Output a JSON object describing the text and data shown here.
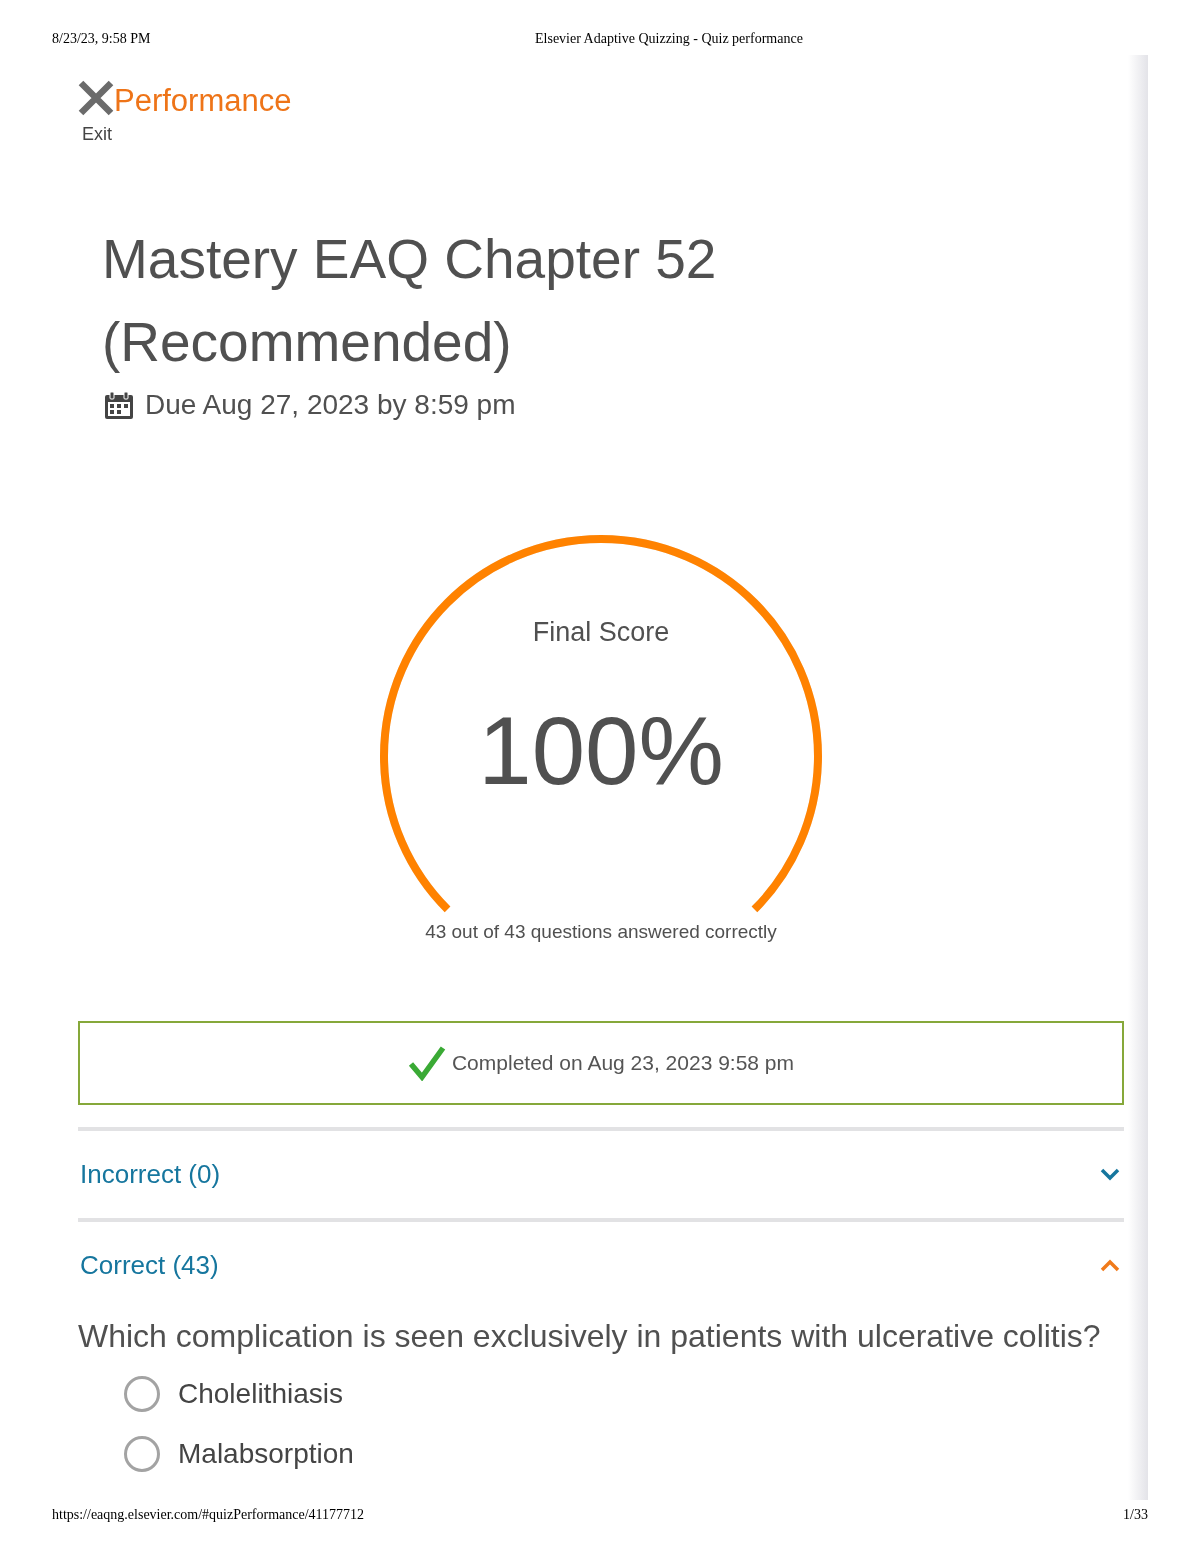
{
  "print_header": {
    "date": "8/23/23, 9:58 PM",
    "title": "Elsevier Adaptive Quizzing - Quiz performance"
  },
  "top_bar": {
    "exit_label": "Exit",
    "title": "Performance"
  },
  "quiz": {
    "title": "Mastery EAQ Chapter 52 (Recommended)",
    "due": "Due Aug 27, 2023 by 8:59 pm"
  },
  "score": {
    "label": "Final Score",
    "value": "100%",
    "level": 1,
    "summary": "43 out of 43 questions answered correctly"
  },
  "completion": {
    "text": "Completed on Aug 23, 2023 9:58 pm"
  },
  "sections": [
    {
      "label": "Incorrect (0)",
      "expanded": false
    },
    {
      "label": "Correct (43)",
      "expanded": true,
      "questions": [
        {
          "text": "Which complication is seen exclusively in patients with ulcerative colitis?",
          "options": [
            {
              "label": "Cholelithiasis",
              "selected": false
            },
            {
              "label": "Malabsorption",
              "selected": false
            }
          ]
        }
      ]
    }
  ],
  "print_footer": {
    "url": "https://eaqng.elsevier.com/#quizPerformance/41177712",
    "page": "1/33"
  }
}
